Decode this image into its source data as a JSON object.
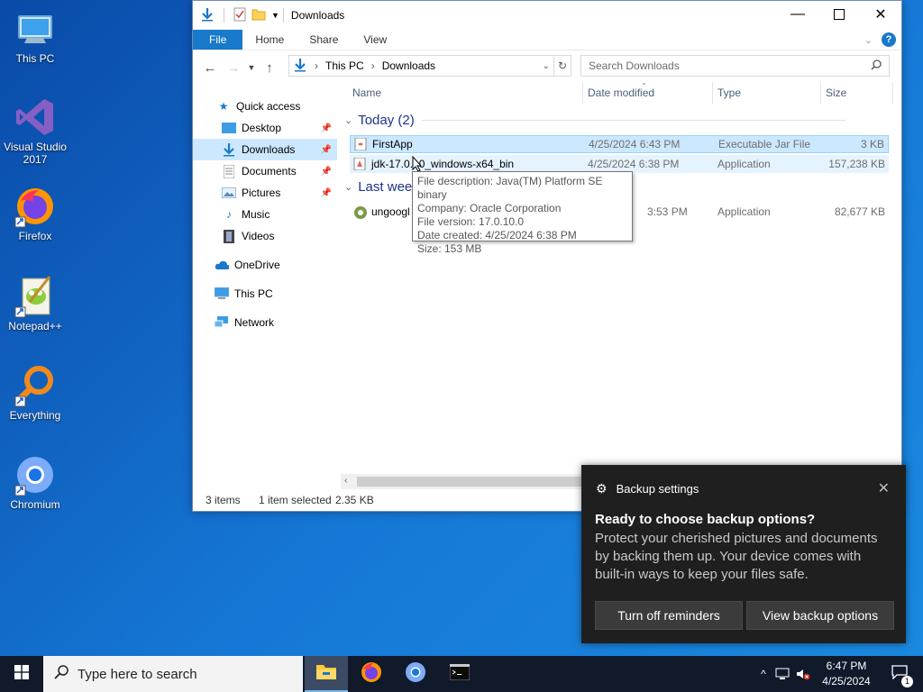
{
  "desktop": {
    "icons": [
      {
        "label": "This PC",
        "icon": "this-pc-icon"
      },
      {
        "label": "Visual Studio 2017",
        "icon": "visual-studio-icon"
      },
      {
        "label": "Firefox",
        "icon": "firefox-icon"
      },
      {
        "label": "Notepad++",
        "icon": "notepadpp-icon"
      },
      {
        "label": "Everything",
        "icon": "everything-icon"
      },
      {
        "label": "Chromium",
        "icon": "chromium-icon"
      }
    ]
  },
  "explorer": {
    "title": "Downloads",
    "ribbon": {
      "file": "File",
      "home": "Home",
      "share": "Share",
      "view": "View"
    },
    "address": {
      "root": "This PC",
      "current": "Downloads"
    },
    "search_placeholder": "Search Downloads",
    "nav": {
      "quick_access": "Quick access",
      "items": [
        "Desktop",
        "Downloads",
        "Documents",
        "Pictures",
        "Music",
        "Videos"
      ],
      "onedrive": "OneDrive",
      "this_pc": "This PC",
      "network": "Network"
    },
    "columns": {
      "name": "Name",
      "date": "Date modified",
      "type": "Type",
      "size": "Size"
    },
    "groups": {
      "today": "Today (2)",
      "last_week": "Last week"
    },
    "files": [
      {
        "name": "FirstApp",
        "date": "4/25/2024 6:43 PM",
        "type": "Executable Jar File",
        "size": "3 KB"
      },
      {
        "name": "jdk-17.0.10_windows-x64_bin",
        "date": "4/25/2024 6:38 PM",
        "type": "Application",
        "size": "157,238 KB"
      },
      {
        "name": "ungoogl",
        "date": "3:53 PM",
        "type": "Application",
        "size": "82,677 KB"
      }
    ],
    "tooltip": [
      "File description: Java(TM) Platform SE binary",
      "Company: Oracle Corporation",
      "File version: 17.0.10.0",
      "Date created: 4/25/2024 6:38 PM",
      "Size: 153 MB"
    ],
    "status": {
      "items": "3 items",
      "selected": "1 item selected",
      "size": "2.35 KB"
    }
  },
  "toast": {
    "app": "Backup settings",
    "title": "Ready to choose backup options?",
    "body": "Protect your cherished pictures and documents by backing them up. Your device comes with built-in ways to keep your files safe.",
    "btn_off": "Turn off reminders",
    "btn_view": "View backup options"
  },
  "taskbar": {
    "search_placeholder": "Type here to search",
    "time": "6:47 PM",
    "date": "4/25/2024",
    "notifications": "1"
  }
}
